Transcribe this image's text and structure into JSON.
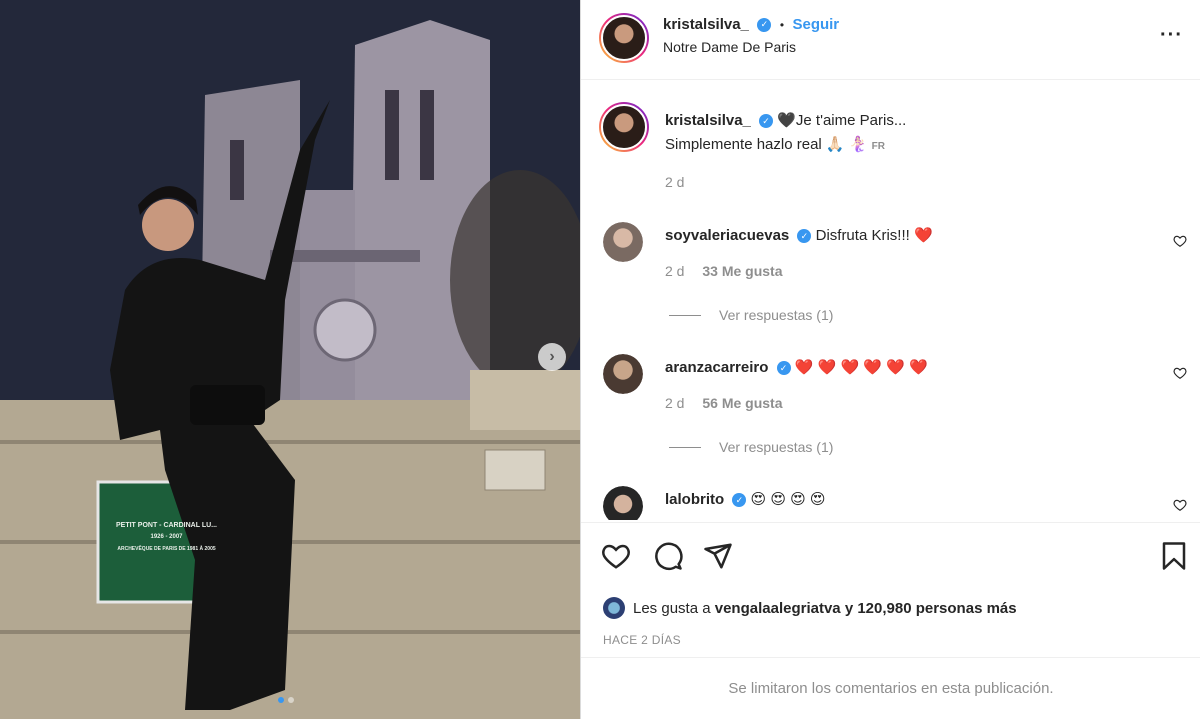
{
  "header": {
    "username": "kristalsilva_",
    "follow_label": "Seguir",
    "location": "Notre Dame De Paris",
    "separator": "•"
  },
  "caption": {
    "username": "kristalsilva_",
    "line1": "🖤Je t'aime Paris...",
    "line2": "Simplemente hazlo real 🙏🏻 🧜🏻‍♀️",
    "lang_badge": "FR",
    "time": "2 d"
  },
  "comments": [
    {
      "username": "soyvaleriacuevas",
      "text": "Disfruta Kris!!! ❤️",
      "time": "2 d",
      "likes": "33 Me gusta",
      "replies": "Ver respuestas (1)"
    },
    {
      "username": "aranzacarreiro",
      "text": "❤️ ❤️ ❤️ ❤️ ❤️ ❤️",
      "time": "2 d",
      "likes": "56 Me gusta",
      "replies": "Ver respuestas (1)"
    },
    {
      "username": "lalobrito",
      "text": "😍 😍 😍 😍"
    }
  ],
  "likes": {
    "prefix": "Les gusta a",
    "user": "vengalaalegriatva",
    "suffix": "y 120,980 personas más"
  },
  "posted_ago": "HACE 2 DÍAS",
  "comments_limited": "Se limitaron los comentarios en esta publicación.",
  "photo_sign": {
    "line1": "PETIT PONT - CARDINAL LU...",
    "line2": "1926 - 2007",
    "line3": "ARCHEVÊQUE DE PARIS DE 1981 À 2005"
  },
  "icons": {
    "more": "more-horizontal-icon",
    "like": "heart-icon",
    "comment": "comment-icon",
    "share": "send-icon",
    "save": "bookmark-icon",
    "next": "chevron-right-icon"
  },
  "colors": {
    "accent": "#3897f0",
    "muted": "#8e8e8e",
    "heart": "#ed4956"
  },
  "carousel": {
    "count": 2,
    "active": 1
  }
}
